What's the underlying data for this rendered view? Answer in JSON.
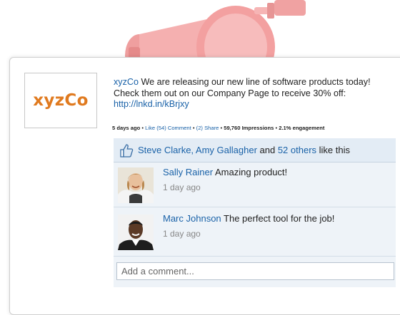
{
  "logo": {
    "text": "xyzCo"
  },
  "post": {
    "author": "xyzCo",
    "text": " We are releasing our new line of software products today! Check them out on our Company Page to receive 30% off: ",
    "link": "http://lnkd.in/kBrjxy"
  },
  "meta": {
    "age": "5 days ago",
    "like": "Like (54)",
    "comment": "Comment",
    "share": "(2) Share",
    "impressions": "59,760 Impressions",
    "engagement": "2.1% engagement"
  },
  "likes": {
    "names": "Steve Clarke, Amy Gallagher",
    "and": " and ",
    "others": "52 others",
    "suffix": " like this"
  },
  "comments": [
    {
      "author": "Sally Rainer",
      "text": " Amazing product!",
      "time": "1 day ago"
    },
    {
      "author": "Marc Johnson",
      "text": " The perfect tool for the job!",
      "time": "1 day ago"
    }
  ],
  "add_comment": {
    "placeholder": "Add a comment..."
  },
  "colors": {
    "link": "#1a62a8",
    "logo": "#e07a1f",
    "megaphone": "#f3a3a3"
  }
}
